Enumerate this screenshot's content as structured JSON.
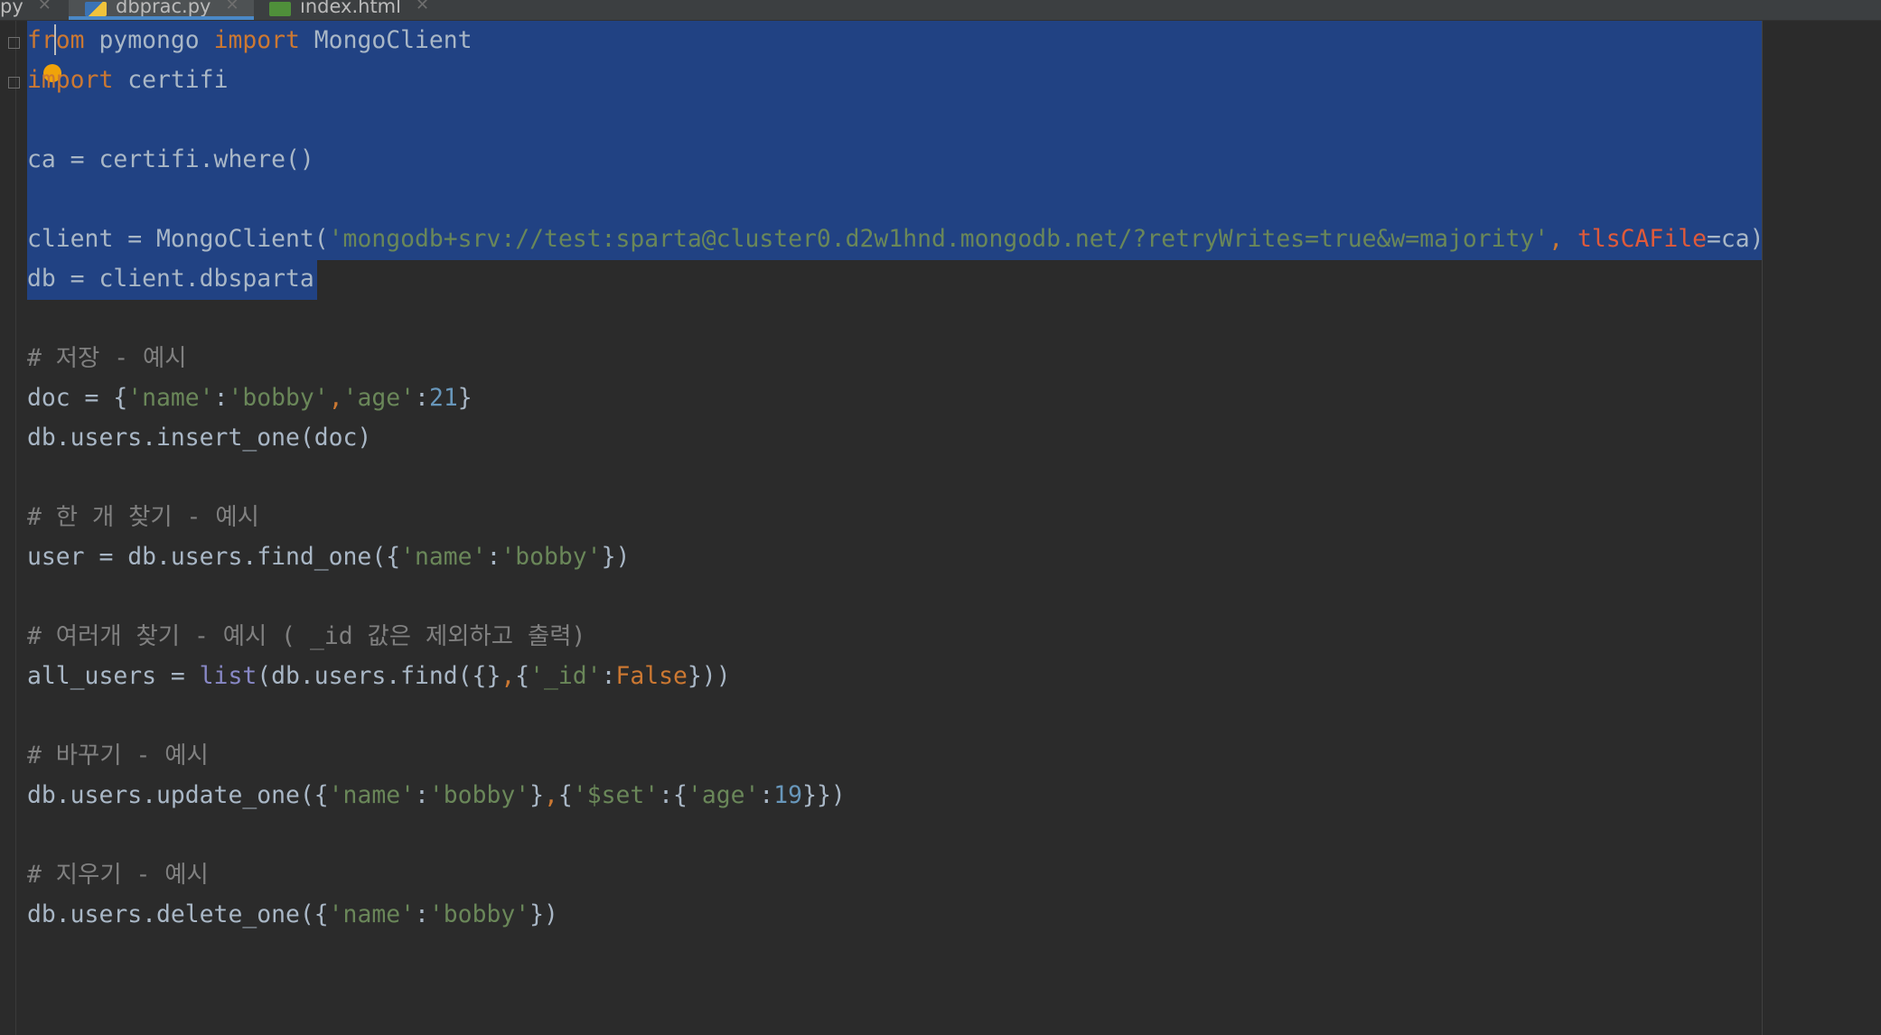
{
  "tabs": [
    {
      "label": "py",
      "icon": "python-file-icon"
    },
    {
      "label": "dbprac.py",
      "icon": "python-file-icon",
      "active": true
    },
    {
      "label": "index.html",
      "icon": "html-file-icon"
    }
  ],
  "colors": {
    "background": "#2b2b2b",
    "selection": "#214283",
    "keyword": "#cc7832",
    "string": "#6a8759",
    "number": "#6897bb",
    "comment": "#808080",
    "text": "#a9b7c6"
  },
  "code": {
    "l1": {
      "kw1": "from",
      "mod": " pymongo ",
      "kw2": "import",
      "name": " MongoClient"
    },
    "l2": {
      "kw": "import",
      "name": " certifi"
    },
    "l4": {
      "text": "ca = certifi.where()"
    },
    "l6": {
      "pre": "client = MongoClient(",
      "str": "'mongodb+srv://test:sparta@cluster0.d2w1hnd.mongodb.net/?retryWrites=true&w=majority'",
      "sep": ", ",
      "param": "tlsCAFile",
      "post": "=ca)"
    },
    "l7": {
      "text": "db = client.dbsparta"
    },
    "c1": "# 저장 - 예시",
    "l10": {
      "pre": "doc = {",
      "s1": "'name'",
      "p1": ":",
      "s2": "'bobby'",
      "p2": ",",
      "s3": "'age'",
      "p3": ":",
      "n1": "21",
      "post": "}"
    },
    "l11": {
      "text": "db.users.insert_one(doc)"
    },
    "c2": "# 한 개 찾기 - 예시",
    "l14": {
      "pre": "user = db.users.find_one({",
      "s1": "'name'",
      "p1": ":",
      "s2": "'bobby'",
      "post": "})"
    },
    "c3": "# 여러개 찾기 - 예시 ( _id 값은 제외하고 출력)",
    "l17": {
      "pre": "all_users = ",
      "builtin": "list",
      "mid": "(db.users.find({}",
      "p1": ",",
      "mid2": "{",
      "s1": "'_id'",
      "p2": ":",
      "kw": "False",
      "post": "}))"
    },
    "c4": "# 바꾸기 - 예시",
    "l20": {
      "pre": "db.users.update_one({",
      "s1": "'name'",
      "p1": ":",
      "s2": "'bobby'",
      "mid": "}",
      "p2": ",",
      "mid2": "{",
      "s3": "'$set'",
      "p3": ":",
      "mid3": "{",
      "s4": "'age'",
      "p4": ":",
      "n1": "19",
      "post": "}})"
    },
    "c5": "# 지우기 - 예시",
    "l23": {
      "pre": "db.users.delete_one({",
      "s1": "'name'",
      "p1": ":",
      "s2": "'bobby'",
      "post": "})"
    }
  }
}
